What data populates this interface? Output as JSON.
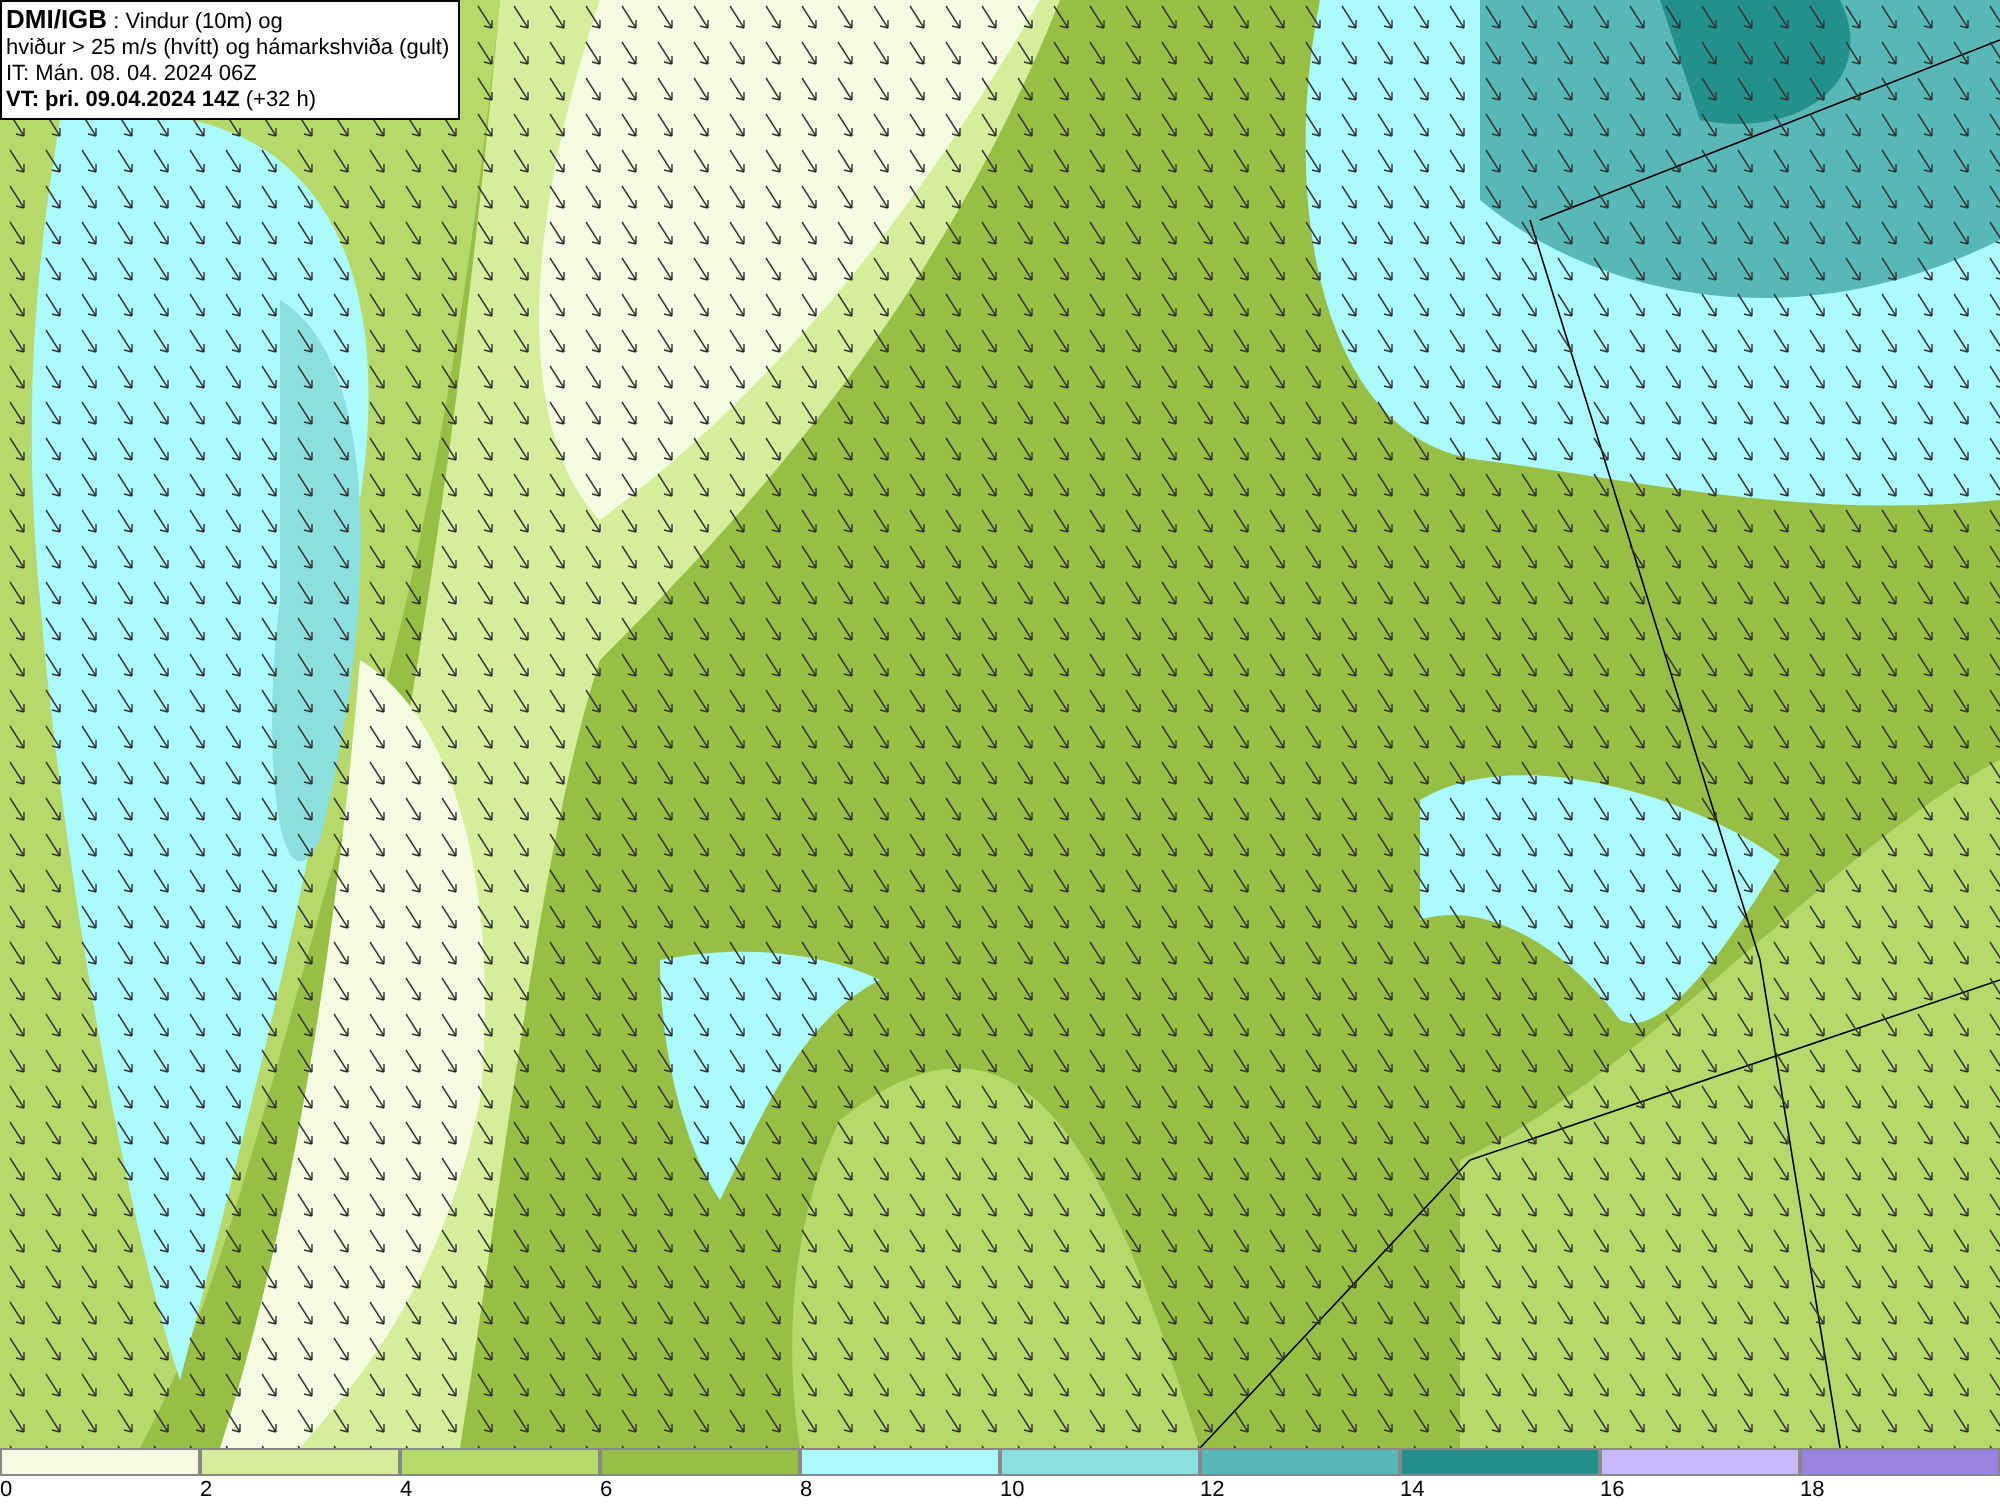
{
  "title_box": {
    "lines": [
      "**DMI/IGB** : Vindur (10m) og",
      "hviður > 25 m/s (hvítt) og hámarkshviða (gult)",
      "IT: Mán. 08. 04. 2024 06Z",
      "**VT: þri. 09.04.2024 14Z** (+32 h)"
    ]
  },
  "legend": [
    {
      "label": "0",
      "color": "#f5fbe1"
    },
    {
      "label": "2",
      "color": "#d6ee9c"
    },
    {
      "label": "4",
      "color": "#b5d96a"
    },
    {
      "label": "6",
      "color": "#97bf45"
    },
    {
      "label": "8",
      "color": "#abfaff"
    },
    {
      "label": "10",
      "color": "#8ddede"
    },
    {
      "label": "12",
      "color": "#58b8b8"
    },
    {
      "label": "14",
      "color": "#23908c"
    },
    {
      "label": "16",
      "color": "#c8b8ff"
    },
    {
      "label": "18",
      "color": "#9b84e0"
    }
  ]
}
